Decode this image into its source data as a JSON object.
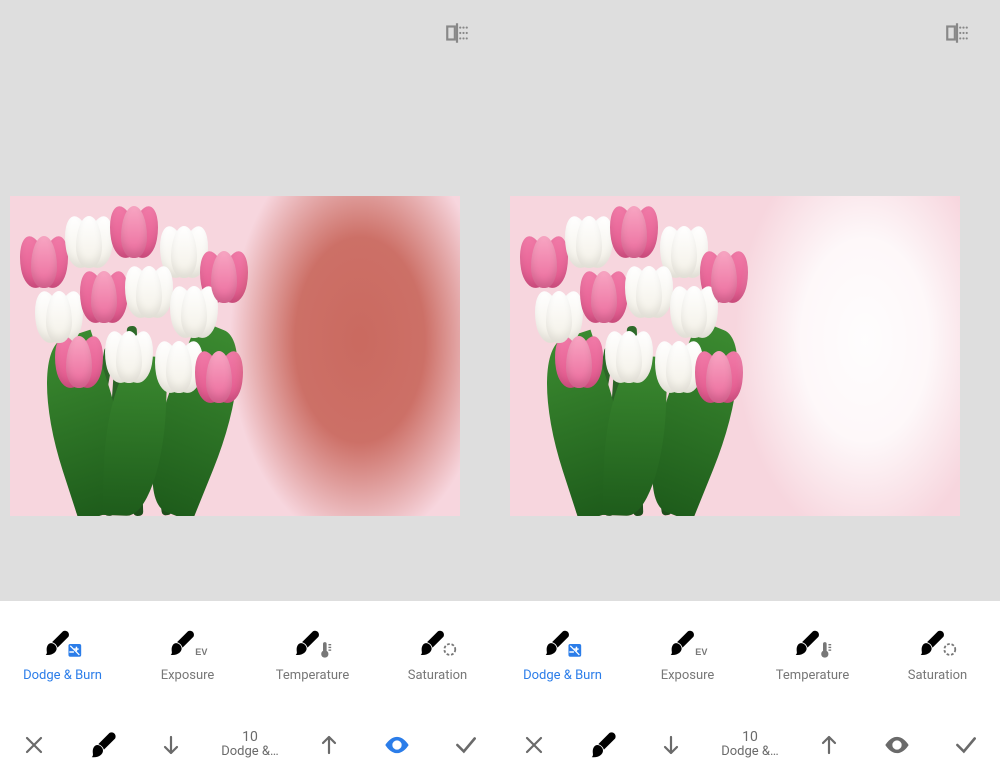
{
  "panels": [
    {
      "adjustments": [
        {
          "label": "Dodge & Burn",
          "active": true
        },
        {
          "label": "Exposure",
          "active": false
        },
        {
          "label": "Temperature",
          "active": false
        },
        {
          "label": "Saturation",
          "active": false
        }
      ],
      "bottom": {
        "value": "10",
        "label": "Dodge &…",
        "eye_active": true
      }
    },
    {
      "adjustments": [
        {
          "label": "Dodge & Burn",
          "active": true
        },
        {
          "label": "Exposure",
          "active": false
        },
        {
          "label": "Temperature",
          "active": false
        },
        {
          "label": "Saturation",
          "active": false
        }
      ],
      "bottom": {
        "value": "10",
        "label": "Dodge &…",
        "eye_active": false
      }
    }
  ]
}
